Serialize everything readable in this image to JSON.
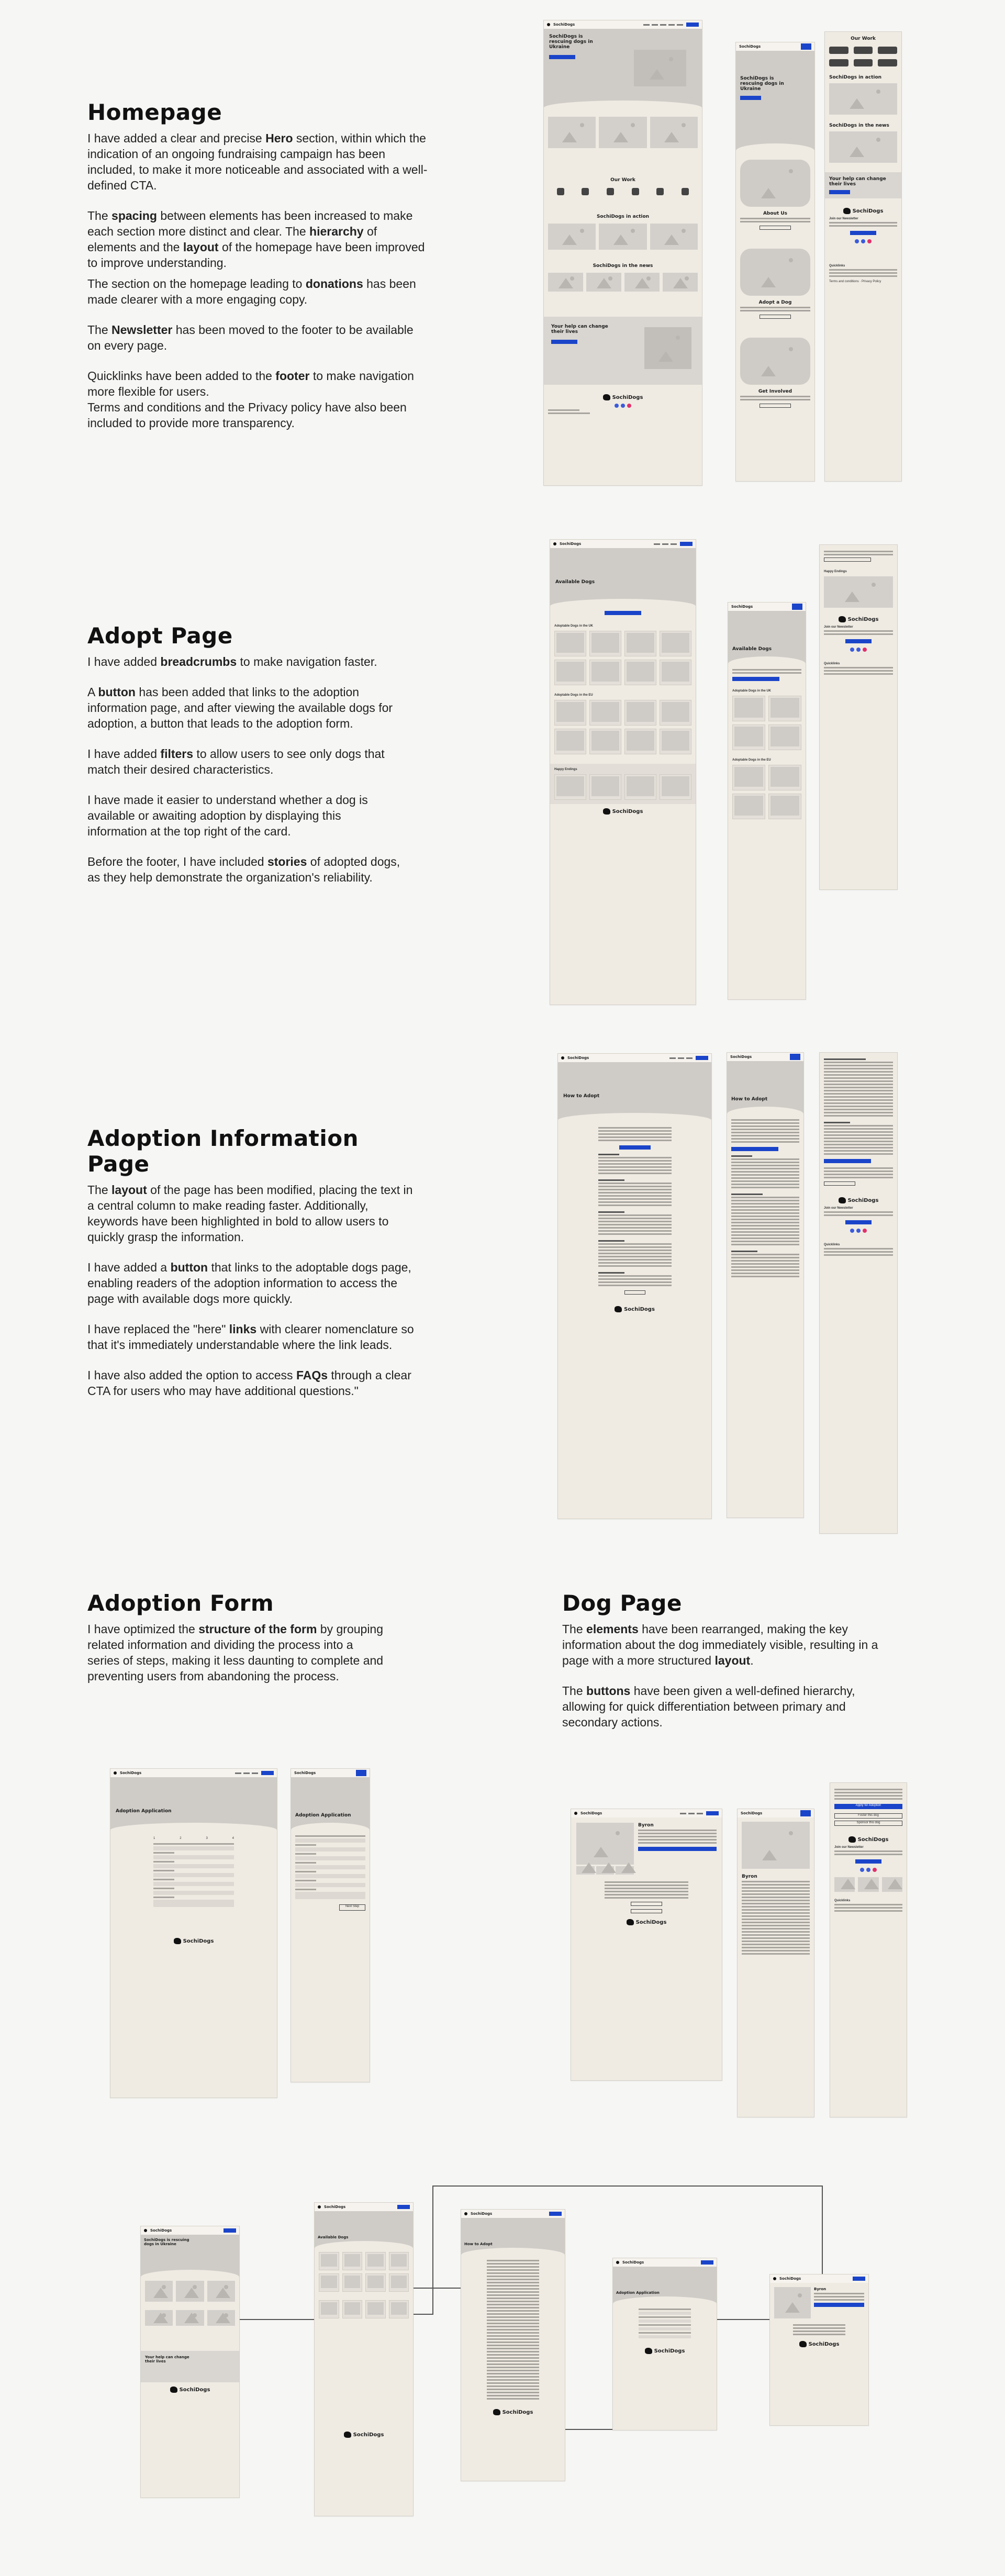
{
  "sections": {
    "homepage": {
      "title": "Homepage",
      "p1_a": "I have added a clear and precise ",
      "p1_b": "Hero",
      "p1_c": " section, within which the indication of an ongoing fundraising campaign has been included, to make it more noticeable and associated with a well-defined CTA.",
      "p2_a": "The ",
      "p2_b": "spacing",
      "p2_c": " between elements has been increased to make each section more distinct and clear. The ",
      "p2_d": "hierarchy",
      "p2_e": " of elements and the ",
      "p2_f": "layout",
      "p2_g": " of the homepage have been improved to improve understanding.",
      "p3_a": "The section on the homepage leading to ",
      "p3_b": "donations",
      "p3_c": " has been made clearer with a more engaging copy.",
      "p4_a": "The ",
      "p4_b": "Newsletter",
      "p4_c": " has been moved to the footer to be available on every page.",
      "p5_a": "Quicklinks have been added to the ",
      "p5_b": "footer",
      "p5_c": " to make navigation more flexible for users.",
      "p5_d": "Terms and conditions and the Privacy policy have also been included to provide more transparency."
    },
    "adopt": {
      "title": "Adopt Page",
      "p1_a": "I have added ",
      "p1_b": "breadcrumbs",
      "p1_c": " to make navigation faster.",
      "p2_a": "A ",
      "p2_b": "button",
      "p2_c": " has been added that links to the adoption information page, and after viewing the available dogs for adoption, a button that leads to the adoption form.",
      "p3_a": "I have added ",
      "p3_b": "filters",
      "p3_c": " to allow users to see only dogs that match their desired characteristics.",
      "p4": "I have made it easier to understand whether a dog is available or awaiting adoption by displaying this information at the top right of the card.",
      "p5_a": "Before the footer, I have included ",
      "p5_b": "stories",
      "p5_c": " of adopted dogs, as they help demonstrate the organization's reliability."
    },
    "adoption_info": {
      "title": "Adoption Information Page",
      "p1_a": "The ",
      "p1_b": "layout",
      "p1_c": " of the page has been modified, placing the text in a central column to make reading faster. Additionally, keywords have been highlighted in bold to allow users to quickly grasp the information.",
      "p2_a": "I have added a ",
      "p2_b": "button",
      "p2_c": " that links to the adoptable dogs page, enabling readers of the adoption information to access the page with available dogs more quickly.",
      "p3_a": "I have replaced the \"here\" ",
      "p3_b": "links",
      "p3_c": " with clearer nomenclature so that it's immediately understandable where the link leads.",
      "p4_a": "I have also added the option to access ",
      "p4_b": "FAQs",
      "p4_c": " through a clear CTA for users who may have additional questions.\""
    },
    "adoption_form": {
      "title": "Adoption Form",
      "p1_a": "I have optimized the ",
      "p1_b": "structure of the form",
      "p1_c": " by grouping related information and dividing the process into a series of steps, making it less daunting to complete and preventing users from abandoning the process."
    },
    "dog_page": {
      "title": "Dog Page",
      "p1_a": "The ",
      "p1_b": "elements",
      "p1_c": " have been rearranged, making the key information about the dog immediately visible, resulting in a page with a more structured ",
      "p1_d": "layout",
      "p1_e": ".",
      "p2_a": "The ",
      "p2_b": "buttons",
      "p2_c": " have been given a well-defined hierarchy, allowing for quick differentiation between primary and secondary actions."
    }
  },
  "mockups": {
    "brand": "SochiDogs",
    "home_hero": "SochiDogs is rescuing dogs in Ukraine",
    "about_us": "About Us",
    "adopt_a_dog": "Adopt a Dog",
    "get_involved": "Get Involved",
    "our_work": "Our Work",
    "in_action": "SochiDogs in action",
    "in_news": "SochiDogs in the news",
    "help_change": "Your help can change their lives",
    "donate": "Donate",
    "join_newsletter": "Join our Newsletter",
    "sign_up": "Sign up today",
    "quicklinks": "Quicklinks",
    "available_dogs": "Available Dogs",
    "adoption_info_btn": "Adoption Information",
    "adoptable_uk": "Adoptable Dogs in the UK",
    "adoptable_eu": "Adoptable Dogs in the EU",
    "happy_endings": "Happy Endings",
    "how_to_adopt": "How to Adopt",
    "adoption_application": "Adoption Application",
    "dog_name": "Byron",
    "apply_adoption": "Apply for Adoption",
    "foster_dog": "Foster this dog",
    "sponsor_dog": "Sponsor this dog",
    "terms": "Terms and conditions",
    "privacy": "Privacy Policy",
    "step1": "1",
    "step2": "2",
    "step3": "3",
    "step4": "4",
    "next_step": "Next Step"
  },
  "colors": {
    "accent": "#1a44c9",
    "frame_bg": "#efebe3",
    "placeholder": "#d3d0cc",
    "facebook": "#3b5bdb",
    "instagram_a": "#c13584",
    "instagram_b": "#e1306c"
  }
}
